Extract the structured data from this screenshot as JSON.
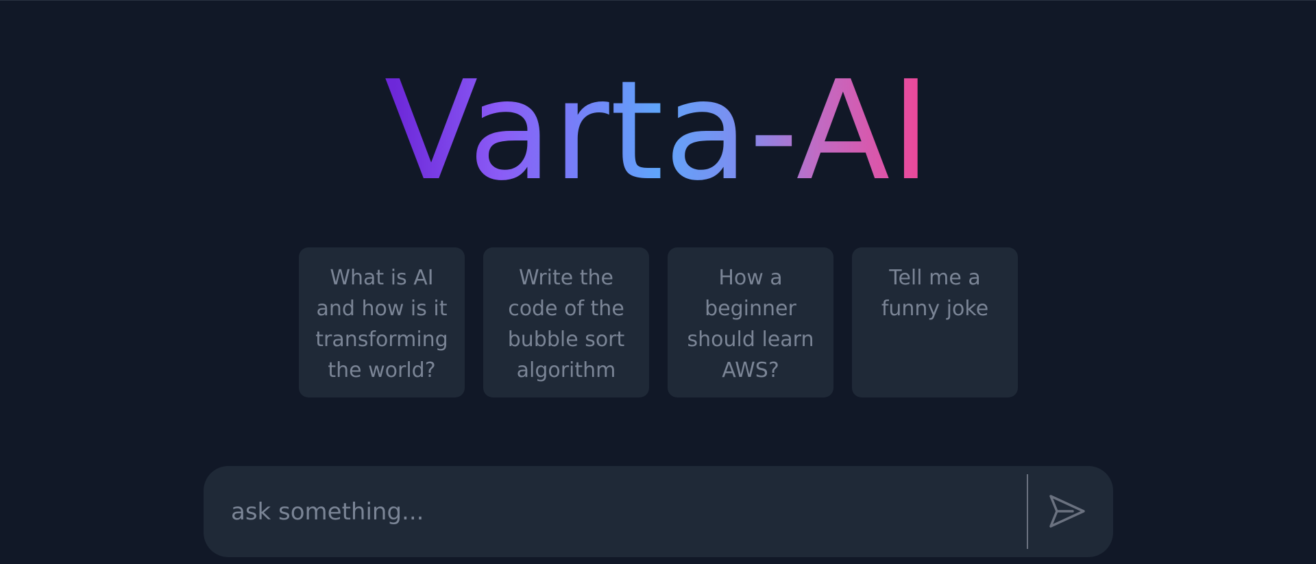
{
  "app": {
    "title": "Varta-AI"
  },
  "suggestions": [
    {
      "text": "What is AI and how is it transforming the world?"
    },
    {
      "text": "Write the code of the bubble sort algorithm"
    },
    {
      "text": "How a beginner should learn AWS?"
    },
    {
      "text": "Tell me a funny joke"
    }
  ],
  "prompt": {
    "value": "",
    "placeholder": "ask something..."
  },
  "icons": {
    "send": "send-icon"
  },
  "colors": {
    "background": "#111827",
    "card": "#1f2937",
    "muted_text": "#7b8596",
    "gradient_start": "#6d28d9",
    "gradient_mid": "#60a5fa",
    "gradient_end": "#ec4899"
  }
}
